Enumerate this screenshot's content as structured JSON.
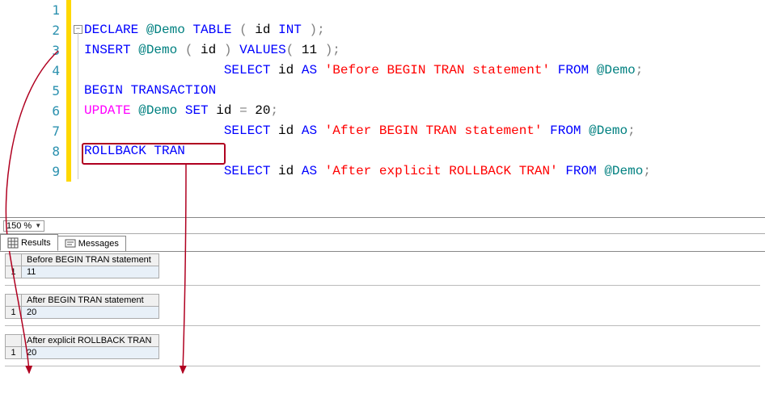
{
  "editor": {
    "lines": [
      {
        "n": 1,
        "segs": []
      },
      {
        "n": 2,
        "segs": [
          {
            "c": "kw-blue",
            "t": "DECLARE"
          },
          {
            "c": "plain",
            "t": " "
          },
          {
            "c": "var-teal",
            "t": "@Demo"
          },
          {
            "c": "plain",
            "t": " "
          },
          {
            "c": "kw-blue",
            "t": "TABLE"
          },
          {
            "c": "plain",
            "t": " "
          },
          {
            "c": "p-grey",
            "t": "("
          },
          {
            "c": "plain",
            "t": " id "
          },
          {
            "c": "kw-blue",
            "t": "INT"
          },
          {
            "c": "plain",
            "t": " "
          },
          {
            "c": "p-grey",
            "t": ");"
          }
        ]
      },
      {
        "n": 3,
        "segs": [
          {
            "c": "kw-blue",
            "t": "INSERT"
          },
          {
            "c": "plain",
            "t": " "
          },
          {
            "c": "var-teal",
            "t": "@Demo"
          },
          {
            "c": "plain",
            "t": " "
          },
          {
            "c": "p-grey",
            "t": "("
          },
          {
            "c": "plain",
            "t": " id "
          },
          {
            "c": "p-grey",
            "t": ")"
          },
          {
            "c": "plain",
            "t": " "
          },
          {
            "c": "kw-blue",
            "t": "VALUES"
          },
          {
            "c": "p-grey",
            "t": "("
          },
          {
            "c": "plain",
            "t": " 11 "
          },
          {
            "c": "p-grey",
            "t": ");"
          }
        ]
      },
      {
        "n": 4,
        "segs": [
          {
            "c": "plain",
            "t": "                  "
          },
          {
            "c": "kw-blue",
            "t": "SELECT"
          },
          {
            "c": "plain",
            "t": " id "
          },
          {
            "c": "kw-blue",
            "t": "AS"
          },
          {
            "c": "plain",
            "t": " "
          },
          {
            "c": "str-red",
            "t": "'Before BEGIN TRAN statement'"
          },
          {
            "c": "plain",
            "t": " "
          },
          {
            "c": "kw-blue",
            "t": "FROM"
          },
          {
            "c": "plain",
            "t": " "
          },
          {
            "c": "var-teal",
            "t": "@Demo"
          },
          {
            "c": "p-grey",
            "t": ";"
          }
        ]
      },
      {
        "n": 5,
        "segs": [
          {
            "c": "kw-blue",
            "t": "BEGIN"
          },
          {
            "c": "plain",
            "t": " "
          },
          {
            "c": "kw-blue",
            "t": "TRANSACTION"
          }
        ]
      },
      {
        "n": 6,
        "segs": [
          {
            "c": "fn-magenta",
            "t": "UPDATE"
          },
          {
            "c": "plain",
            "t": " "
          },
          {
            "c": "var-teal",
            "t": "@Demo"
          },
          {
            "c": "plain",
            "t": " "
          },
          {
            "c": "kw-blue",
            "t": "SET"
          },
          {
            "c": "plain",
            "t": " id "
          },
          {
            "c": "p-grey",
            "t": "="
          },
          {
            "c": "plain",
            "t": " 20"
          },
          {
            "c": "p-grey",
            "t": ";"
          }
        ]
      },
      {
        "n": 7,
        "segs": [
          {
            "c": "plain",
            "t": "                  "
          },
          {
            "c": "kw-blue",
            "t": "SELECT"
          },
          {
            "c": "plain",
            "t": " id "
          },
          {
            "c": "kw-blue",
            "t": "AS"
          },
          {
            "c": "plain",
            "t": " "
          },
          {
            "c": "str-red",
            "t": "'After BEGIN TRAN statement'"
          },
          {
            "c": "plain",
            "t": " "
          },
          {
            "c": "kw-blue",
            "t": "FROM"
          },
          {
            "c": "plain",
            "t": " "
          },
          {
            "c": "var-teal",
            "t": "@Demo"
          },
          {
            "c": "p-grey",
            "t": ";"
          }
        ]
      },
      {
        "n": 8,
        "segs": [
          {
            "c": "kw-blue",
            "t": "ROLLBACK"
          },
          {
            "c": "plain",
            "t": " "
          },
          {
            "c": "kw-blue",
            "t": "TRAN"
          }
        ]
      },
      {
        "n": 9,
        "segs": [
          {
            "c": "plain",
            "t": "                  "
          },
          {
            "c": "kw-blue",
            "t": "SELECT"
          },
          {
            "c": "plain",
            "t": " id "
          },
          {
            "c": "kw-blue",
            "t": "AS"
          },
          {
            "c": "plain",
            "t": " "
          },
          {
            "c": "str-red",
            "t": "'After explicit ROLLBACK TRAN'"
          },
          {
            "c": "plain",
            "t": " "
          },
          {
            "c": "kw-blue",
            "t": "FROM"
          },
          {
            "c": "plain",
            "t": " "
          },
          {
            "c": "var-teal",
            "t": "@Demo"
          },
          {
            "c": "p-grey",
            "t": ";"
          }
        ]
      }
    ]
  },
  "zoom": {
    "label": "150 %"
  },
  "tabs": {
    "results": "Results",
    "messages": "Messages"
  },
  "results": [
    {
      "header": "Before BEGIN TRAN statement",
      "row": "1",
      "value": "11"
    },
    {
      "header": "After BEGIN TRAN statement",
      "row": "1",
      "value": "20"
    },
    {
      "header": "After explicit ROLLBACK TRAN",
      "row": "1",
      "value": "20"
    }
  ]
}
